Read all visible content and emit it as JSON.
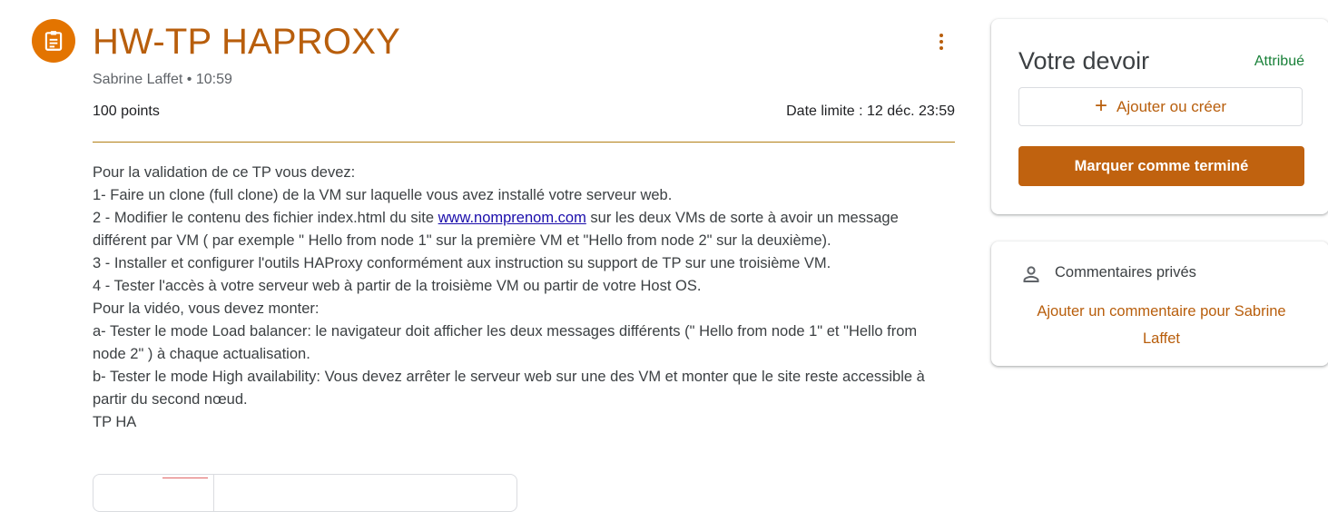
{
  "assignment": {
    "icon": "assignment-icon",
    "title": "HW-TP HAPROXY",
    "author": "Sabrine Laffet",
    "separator": "•",
    "time": "10:59",
    "points": "100 points",
    "due": "Date limite : 12 déc. 23:59",
    "more_icon": "more-vert-icon",
    "accent_color": "#b85e0c"
  },
  "description": {
    "lines": [
      "Pour la validation de ce TP vous devez:",
      "1- Faire un clone (full clone) de la VM sur laquelle vous avez installé votre serveur web.",
      "2 - Modifier le contenu des fichier index.html du site ",
      "www.nomprenom.com",
      " sur les deux VMs de sorte à avoir un message différent par VM ( par exemple \" Hello from node 1\" sur la première VM et \"Hello from node 2\" sur la deuxième).",
      "3 - Installer et configurer l'outils HAProxy conformément aux instruction su support de TP sur une troisième VM.",
      "4 - Tester l'accès à votre serveur web à partir de la troisième VM ou partir de votre Host OS.",
      "Pour la vidéo, vous devez monter:",
      "a- Tester le mode Load balancer: le navigateur doit afficher les deux messages différents (\" Hello from node 1\" et \"Hello from node 2\" ) à chaque actualisation.",
      "b- Tester le mode High availability: Vous devez arrêter le serveur web sur une des VM et monter que le site reste accessible à partir du second nœud.",
      "TP HA"
    ]
  },
  "your_work": {
    "heading": "Votre devoir",
    "status": "Attribué",
    "status_color": "#188038",
    "add_icon": "plus-icon",
    "add_plus": "+",
    "add_label": "Ajouter ou créer",
    "done_label": "Marquer comme terminé",
    "done_color": "#c0620f"
  },
  "private_comments": {
    "icon": "person-icon",
    "heading": "Commentaires privés",
    "add_comment": "Ajouter un commentaire pour Sabrine Laffet"
  }
}
